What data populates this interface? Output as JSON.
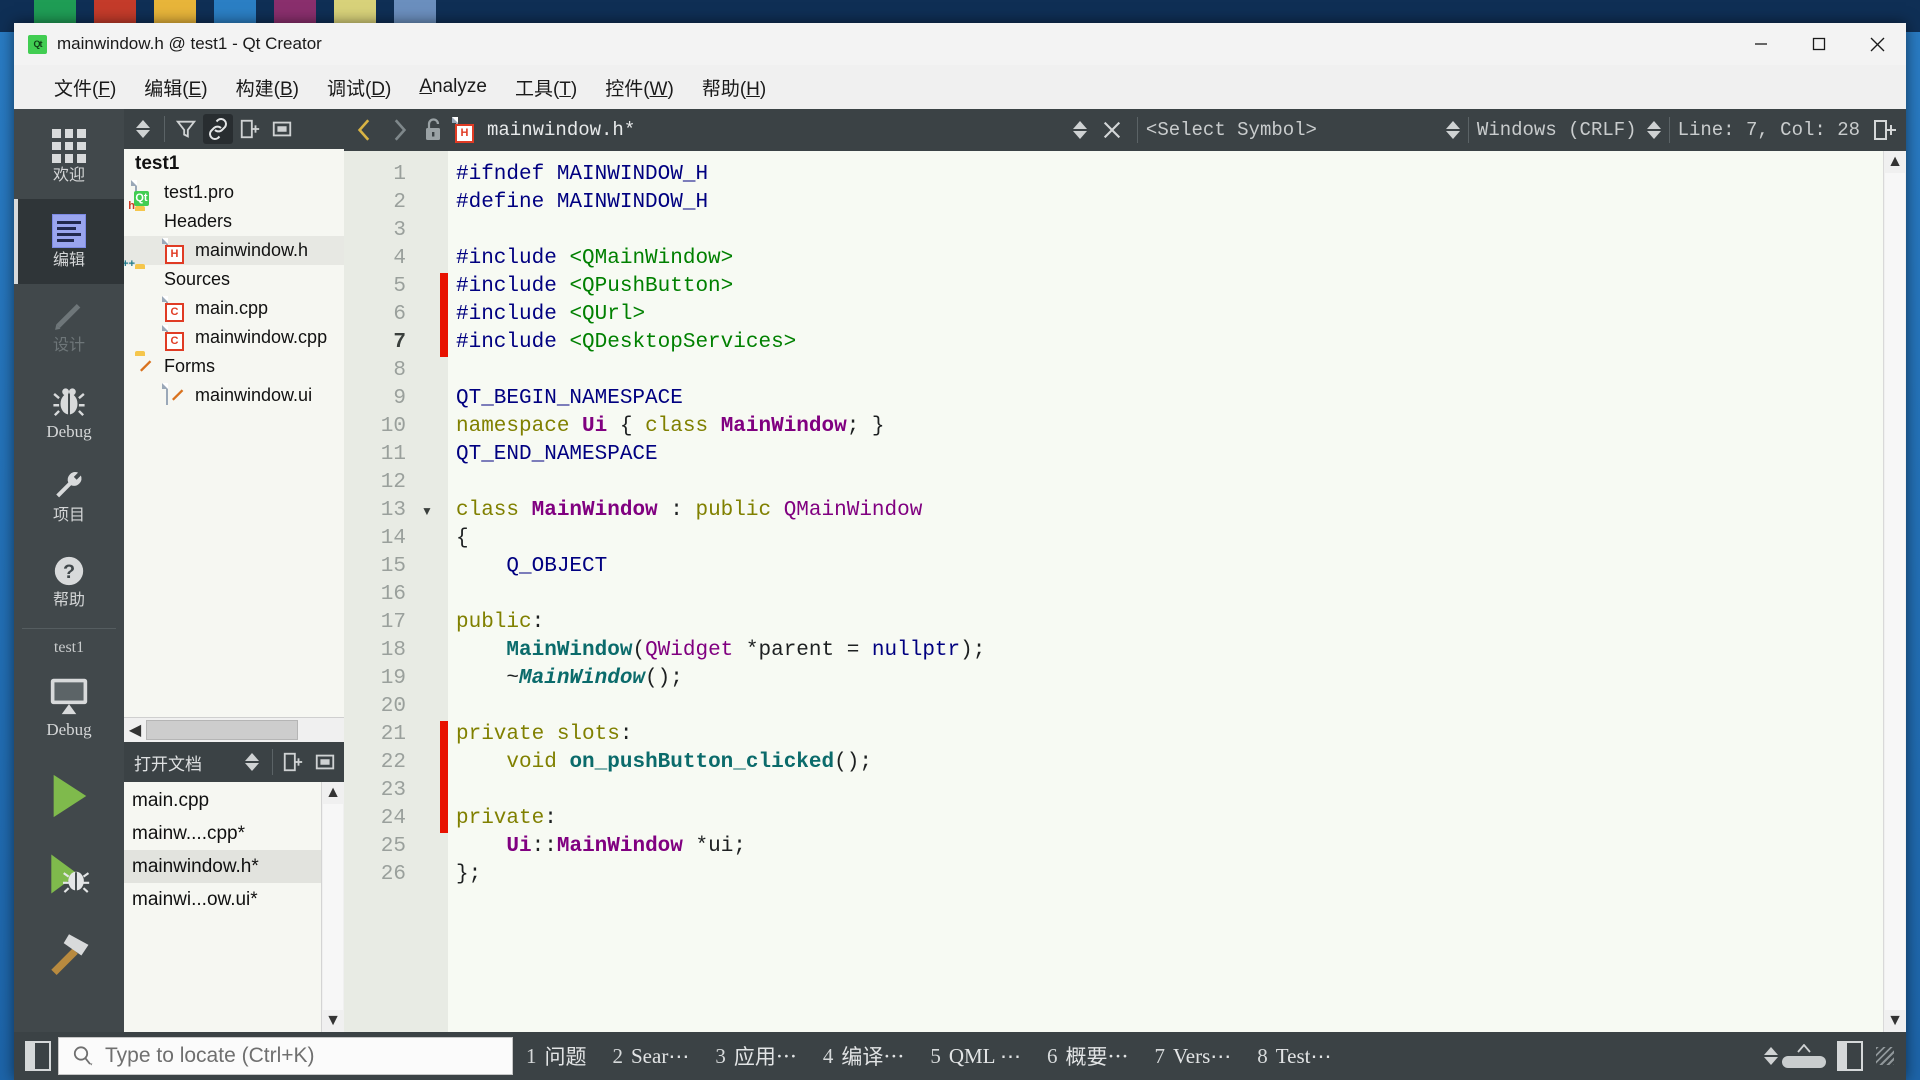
{
  "window": {
    "title": "mainwindow.h @ test1 - Qt Creator",
    "logo_text": "Qt",
    "minimize_label": "minimize-window",
    "maximize_label": "maximize-window",
    "close_label": "close-window"
  },
  "menubar": {
    "items": [
      {
        "label": "文件(F)",
        "mnemonic": "F"
      },
      {
        "label": "编辑(E)",
        "mnemonic": "E"
      },
      {
        "label": "构建(B)",
        "mnemonic": "B"
      },
      {
        "label": "调试(D)",
        "mnemonic": "D"
      },
      {
        "label": "Analyze",
        "mnemonic": "A"
      },
      {
        "label": "工具(T)",
        "mnemonic": "T"
      },
      {
        "label": "控件(W)",
        "mnemonic": "W"
      },
      {
        "label": "帮助(H)",
        "mnemonic": "H"
      }
    ]
  },
  "modebar": {
    "modes": [
      {
        "label": "欢迎",
        "icon": "grid-icon",
        "state": "normal"
      },
      {
        "label": "编辑",
        "icon": "edit-lines-icon",
        "state": "active"
      },
      {
        "label": "设计",
        "icon": "pencil-icon",
        "state": "disabled"
      },
      {
        "label": "Debug",
        "icon": "bug-icon",
        "state": "normal"
      },
      {
        "label": "项目",
        "icon": "wrench-icon",
        "state": "normal"
      },
      {
        "label": "帮助",
        "icon": "question-circle-icon",
        "state": "normal"
      }
    ],
    "kit": {
      "project_name": "test1",
      "build_config": "Debug",
      "target_icon": "monitor-icon",
      "run_icon": "play-icon",
      "debug_icon": "play-bug-icon",
      "build_icon": "hammer-icon"
    }
  },
  "project_dock": {
    "title": "test1",
    "toolbar": {
      "sync_label": "sync-selection",
      "filter_label": "filter",
      "link_label": "link-with-editor",
      "split_label": "add-split",
      "close_label": "close-panel"
    },
    "tree": [
      {
        "label": "test1",
        "level": 0,
        "icon": "project-root",
        "selected": false
      },
      {
        "label": "test1.pro",
        "level": 1,
        "icon": "qt-pro-file",
        "selected": false
      },
      {
        "label": "Headers",
        "level": 1,
        "icon": "folder-h",
        "selected": false
      },
      {
        "label": "mainwindow.h",
        "level": 2,
        "icon": "header-file",
        "selected": true
      },
      {
        "label": "Sources",
        "level": 1,
        "icon": "folder-cpp",
        "selected": false
      },
      {
        "label": "main.cpp",
        "level": 2,
        "icon": "cpp-file",
        "selected": false
      },
      {
        "label": "mainwindow.cpp",
        "level": 2,
        "icon": "cpp-file",
        "selected": false
      },
      {
        "label": "Forms",
        "level": 1,
        "icon": "folder-forms",
        "selected": false
      },
      {
        "label": "mainwindow.ui",
        "level": 2,
        "icon": "ui-file",
        "selected": false
      }
    ]
  },
  "open_documents": {
    "title": "打开文档",
    "items": [
      {
        "label": "main.cpp",
        "selected": false
      },
      {
        "label": "mainw....cpp*",
        "selected": false
      },
      {
        "label": "mainwindow.h*",
        "selected": true
      },
      {
        "label": "mainwi...ow.ui*",
        "selected": false
      }
    ]
  },
  "editor_toolbar": {
    "back_label": "navigate-back",
    "forward_label": "navigate-forward",
    "lock_label": "toggle-read-only",
    "file_name": "mainwindow.h*",
    "file_icon": "header-file",
    "symbol_selector": "<Select Symbol>",
    "line_ending": "Windows (CRLF)",
    "cursor_position": "Line: 7, Col: 28",
    "split_label": "split-editor",
    "close_label": "close-document"
  },
  "editor": {
    "current_line": 7,
    "lines": [
      {
        "n": 1,
        "changed": false,
        "fold": ""
      },
      {
        "n": 2,
        "changed": false,
        "fold": ""
      },
      {
        "n": 3,
        "changed": false,
        "fold": ""
      },
      {
        "n": 4,
        "changed": false,
        "fold": ""
      },
      {
        "n": 5,
        "changed": true,
        "fold": ""
      },
      {
        "n": 6,
        "changed": true,
        "fold": ""
      },
      {
        "n": 7,
        "changed": true,
        "fold": ""
      },
      {
        "n": 8,
        "changed": false,
        "fold": ""
      },
      {
        "n": 9,
        "changed": false,
        "fold": ""
      },
      {
        "n": 10,
        "changed": false,
        "fold": ""
      },
      {
        "n": 11,
        "changed": false,
        "fold": ""
      },
      {
        "n": 12,
        "changed": false,
        "fold": ""
      },
      {
        "n": 13,
        "changed": false,
        "fold": "▼"
      },
      {
        "n": 14,
        "changed": false,
        "fold": ""
      },
      {
        "n": 15,
        "changed": false,
        "fold": ""
      },
      {
        "n": 16,
        "changed": false,
        "fold": ""
      },
      {
        "n": 17,
        "changed": false,
        "fold": ""
      },
      {
        "n": 18,
        "changed": false,
        "fold": ""
      },
      {
        "n": 19,
        "changed": false,
        "fold": ""
      },
      {
        "n": 20,
        "changed": false,
        "fold": ""
      },
      {
        "n": 21,
        "changed": true,
        "fold": ""
      },
      {
        "n": 22,
        "changed": true,
        "fold": ""
      },
      {
        "n": 23,
        "changed": true,
        "fold": ""
      },
      {
        "n": 24,
        "changed": true,
        "fold": ""
      },
      {
        "n": 25,
        "changed": false,
        "fold": ""
      },
      {
        "n": 26,
        "changed": false,
        "fold": ""
      }
    ],
    "source_text": [
      "#ifndef MAINWINDOW_H",
      "#define MAINWINDOW_H",
      "",
      "#include <QMainWindow>",
      "#include <QPushButton>",
      "#include <QUrl>",
      "#include <QDesktopServices>",
      "",
      "QT_BEGIN_NAMESPACE",
      "namespace Ui { class MainWindow; }",
      "QT_END_NAMESPACE",
      "",
      "class MainWindow : public QMainWindow",
      "{",
      "    Q_OBJECT",
      "",
      "public:",
      "    MainWindow(QWidget *parent = nullptr);",
      "    ~MainWindow();",
      "",
      "private slots:",
      "    void on_pushButton_clicked();",
      "",
      "private:",
      "    Ui::MainWindow *ui;",
      "};"
    ]
  },
  "bottom_bar": {
    "sidebar_toggle_label": "toggle-left-sidebar",
    "locator_placeholder": "Type to locate (Ctrl+K)",
    "locator_value": "",
    "search_icon": "search-icon",
    "output_panes": [
      {
        "number": "1",
        "label": "问题"
      },
      {
        "number": "2",
        "label": "Sear⋯"
      },
      {
        "number": "3",
        "label": "应用⋯"
      },
      {
        "number": "4",
        "label": "编译⋯"
      },
      {
        "number": "5",
        "label": "QML ⋯"
      },
      {
        "number": "6",
        "label": "概要⋯"
      },
      {
        "number": "7",
        "label": "Vers⋯"
      },
      {
        "number": "8",
        "label": "Test⋯"
      }
    ],
    "progress_label": "progress-indicator",
    "right_sidebar_toggle_label": "toggle-right-sidebar"
  },
  "colors": {
    "accent_green": "#41cd52",
    "chrome_dark": "#3b4245",
    "modebar": "#41484b",
    "mode_active": "#2f3538",
    "editor_bg": "#f7faf3",
    "gutter_bg": "#e8ebe4",
    "change_marker": "#e81100",
    "keyword": "#808000",
    "preprocessor": "#000080",
    "string": "#008000",
    "type": "#800080",
    "function": "#0b6b6b"
  }
}
